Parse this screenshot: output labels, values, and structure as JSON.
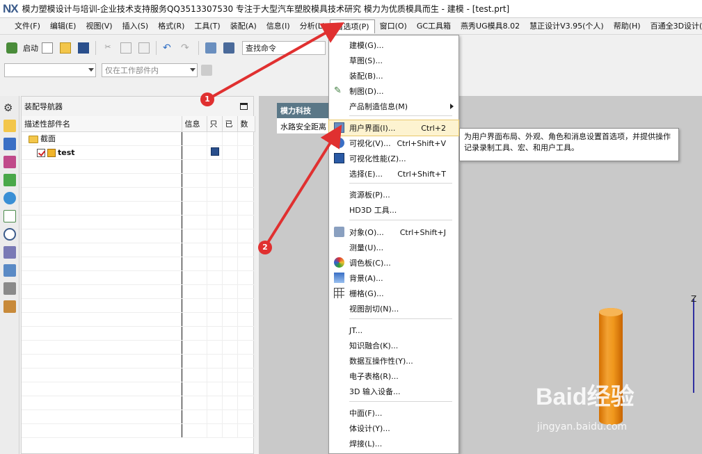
{
  "titlebar": {
    "logo": "NX",
    "title": "模力塑模设计与培训-企业技术支持服务QQ3513307530  专注于大型汽车塑胶模具技术研究  模力为优质模具而生 - 建模 - [test.prt]"
  },
  "menubar": {
    "items": [
      "文件(F)",
      "编辑(E)",
      "视图(V)",
      "插入(S)",
      "格式(R)",
      "工具(T)",
      "装配(A)",
      "信息(I)",
      "分析(L)",
      "首选项(P)",
      "窗口(O)",
      "GC工具箱",
      "燕秀UG模具8.02",
      "慧正设计V3.95(个人)",
      "帮助(H)",
      "百通全3D设计(D)"
    ],
    "active_index": 9
  },
  "toolbar": {
    "start_label": "启动",
    "find_command_placeholder": "查找命令",
    "selection_filter_value": "",
    "work_part_scope": "仅在工作部件内"
  },
  "navigator": {
    "title": "装配导航器",
    "columns": [
      "描述性部件名",
      "信息",
      "只",
      "已",
      "数"
    ],
    "rows": [
      {
        "name": "截面",
        "type": "folder"
      },
      {
        "name": "test",
        "type": "part"
      }
    ]
  },
  "graphics": {
    "info_header": "模力科技",
    "info_text": "水路安全距离",
    "axis_label": "Z",
    "watermark": "Baid经验",
    "watermark_url": "jingyan.baidu.com"
  },
  "dropdown": {
    "items": [
      {
        "label": "建模(G)...",
        "shortcut": "",
        "icon": "model-icon"
      },
      {
        "label": "草图(S)...",
        "shortcut": "",
        "icon": ""
      },
      {
        "label": "装配(B)...",
        "shortcut": "",
        "icon": ""
      },
      {
        "label": "制图(D)...",
        "shortcut": "",
        "icon": "drafting-icon"
      },
      {
        "label": "产品制造信息(M)",
        "shortcut": "",
        "icon": "",
        "submenu": true
      },
      {
        "label": "用户界面(I)...",
        "shortcut": "Ctrl+2",
        "icon": "user-interface-icon",
        "highlighted": true
      },
      {
        "label": "可视化(V)...",
        "shortcut": "Ctrl+Shift+V",
        "icon": "visualization-icon"
      },
      {
        "label": "可视化性能(Z)...",
        "shortcut": "",
        "icon": "visualization-performance-icon"
      },
      {
        "label": "选择(E)...",
        "shortcut": "Ctrl+Shift+T",
        "icon": ""
      },
      {
        "label": "资源板(P)...",
        "shortcut": "",
        "icon": ""
      },
      {
        "label": "HD3D 工具...",
        "shortcut": "",
        "icon": ""
      },
      {
        "label": "对象(O)...",
        "shortcut": "Ctrl+Shift+J",
        "icon": "object-icon"
      },
      {
        "label": "测量(U)...",
        "shortcut": "",
        "icon": ""
      },
      {
        "label": "调色板(C)...",
        "shortcut": "",
        "icon": "palette-icon"
      },
      {
        "label": "背景(A)...",
        "shortcut": "",
        "icon": "background-icon"
      },
      {
        "label": "栅格(G)...",
        "shortcut": "",
        "icon": "grid-icon"
      },
      {
        "label": "视图剖切(N)...",
        "shortcut": "",
        "icon": ""
      },
      {
        "label": "JT...",
        "shortcut": "",
        "icon": ""
      },
      {
        "label": "知识融合(K)...",
        "shortcut": "",
        "icon": ""
      },
      {
        "label": "数据互操作性(Y)...",
        "shortcut": "",
        "icon": ""
      },
      {
        "label": "电子表格(R)...",
        "shortcut": "",
        "icon": ""
      },
      {
        "label": "3D 输入设备...",
        "shortcut": "",
        "icon": ""
      },
      {
        "label": "中面(F)...",
        "shortcut": "",
        "icon": ""
      },
      {
        "label": "体设计(Y)...",
        "shortcut": "",
        "icon": ""
      },
      {
        "label": "焊接(L)...",
        "shortcut": "",
        "icon": ""
      }
    ]
  },
  "tooltip": {
    "text": "为用户界面布局、外观、角色和消息设置首选项，并提供操作记录录制工具、宏、和用户工具。"
  },
  "annotations": {
    "badge1": "1",
    "badge2": "2",
    "arrow_color": "#e03030"
  },
  "colors": {
    "accent": "#3a5a8a",
    "highlight": "#fdf3d0",
    "cylinder": "#f0981c",
    "info_header_bg": "#5a7787"
  }
}
